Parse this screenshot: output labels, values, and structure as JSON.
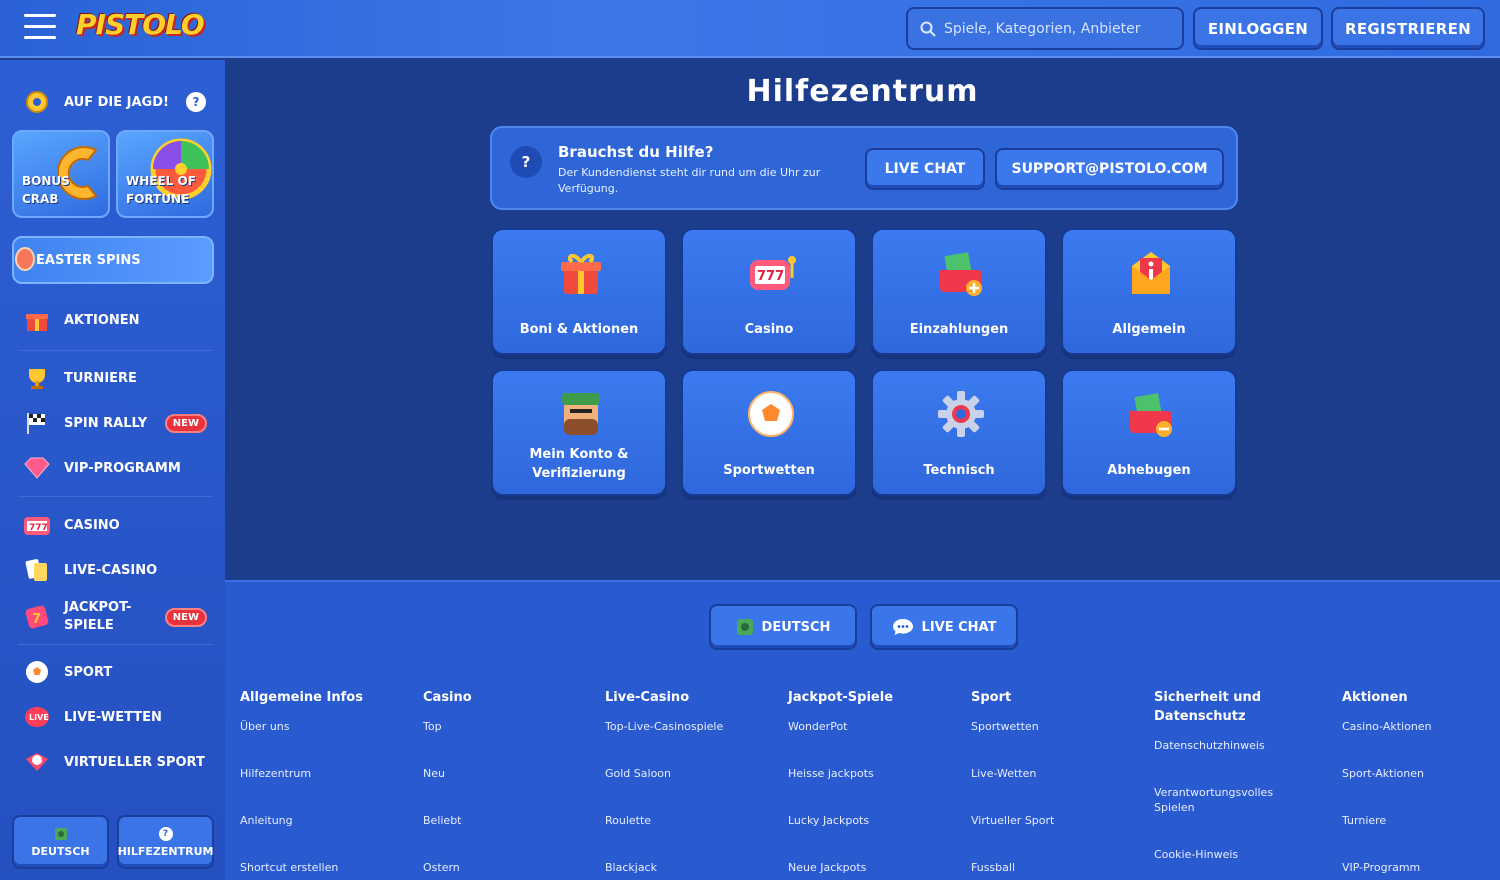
{
  "header": {
    "logo": "PISTOLO",
    "search_placeholder": "Spiele, Kategorien, Anbieter",
    "login": "EINLOGGEN",
    "register": "REGISTRIEREN"
  },
  "sidebar": {
    "hunt": "AUF DIE JAGD!",
    "hunt_help": "?",
    "promos": [
      {
        "label1": "BONUS",
        "label2": "CRAB"
      },
      {
        "label1": "WHEEL OF",
        "label2": "FORTUNE"
      }
    ],
    "easter": "EASTER SPINS",
    "items": [
      {
        "label": "AKTIONEN",
        "icon": "gift-icon"
      },
      {
        "label": "TURNIERE",
        "icon": "trophy-icon"
      },
      {
        "label": "SPIN RALLY",
        "icon": "flag-icon",
        "badge": "NEW"
      },
      {
        "label": "VIP-PROGRAMM",
        "icon": "diamond-icon"
      },
      {
        "label": "CASINO",
        "icon": "slot-icon"
      },
      {
        "label": "LIVE-CASINO",
        "icon": "cards-icon"
      },
      {
        "label1": "JACKPOT-",
        "label2": "SPIELE",
        "icon": "jackpot-icon",
        "badge": "NEW"
      },
      {
        "label": "SPORT",
        "icon": "ball-icon"
      },
      {
        "label": "LIVE-WETTEN",
        "icon": "live-icon"
      },
      {
        "label": "VIRTUELLER SPORT",
        "icon": "virtual-icon"
      }
    ],
    "bottom": {
      "lang": "DEUTSCH",
      "help": "HILFEZENTRUM",
      "help_icon": "?"
    }
  },
  "main": {
    "title": "Hilfezentrum",
    "help": {
      "icon": "?",
      "heading": "Brauchst du Hilfe?",
      "text": "Der Kundendienst steht dir rund um die Uhr zur Verfügung.",
      "live_chat": "LIVE CHAT",
      "email": "SUPPORT@PISTOLO.COM"
    },
    "tiles": [
      {
        "label": "Boni & Aktionen"
      },
      {
        "label": "Casino"
      },
      {
        "label": "Einzahlungen"
      },
      {
        "label": "Allgemein"
      },
      {
        "label1": "Mein Konto &",
        "label2": "Verifizierung"
      },
      {
        "label": "Sportwetten"
      },
      {
        "label": "Technisch"
      },
      {
        "label": "Abhebugen"
      }
    ]
  },
  "footer": {
    "lang": "DEUTSCH",
    "chat": "LIVE CHAT",
    "columns": [
      {
        "title": "Allgemeine Infos",
        "links": [
          "Über uns",
          "Hilfezentrum",
          "Anleitung",
          "Shortcut erstellen"
        ]
      },
      {
        "title": "Casino",
        "links": [
          "Top",
          "Neu",
          "Beliebt",
          "Ostern"
        ]
      },
      {
        "title": "Live-Casino",
        "links": [
          "Top-Live-Casinospiele",
          "Gold Saloon",
          "Roulette",
          "Blackjack"
        ]
      },
      {
        "title": "Jackpot-Spiele",
        "links": [
          "WonderPot",
          "Heisse jackpots",
          "Lucky Jackpots",
          "Neue Jackpots"
        ]
      },
      {
        "title": "Sport",
        "links": [
          "Sportwetten",
          "Live-Wetten",
          "Virtueller Sport",
          "Fussball"
        ]
      },
      {
        "title1": "Sicherheit und",
        "title2": "Datenschutz",
        "links": [
          "Datenschutzhinweis",
          "Verantwortungsvolles Spielen",
          "Cookie-Hinweis"
        ]
      },
      {
        "title": "Aktionen",
        "links": [
          "Casino-Aktionen",
          "Sport-Aktionen",
          "Turniere",
          "VIP-Programm"
        ]
      }
    ]
  }
}
